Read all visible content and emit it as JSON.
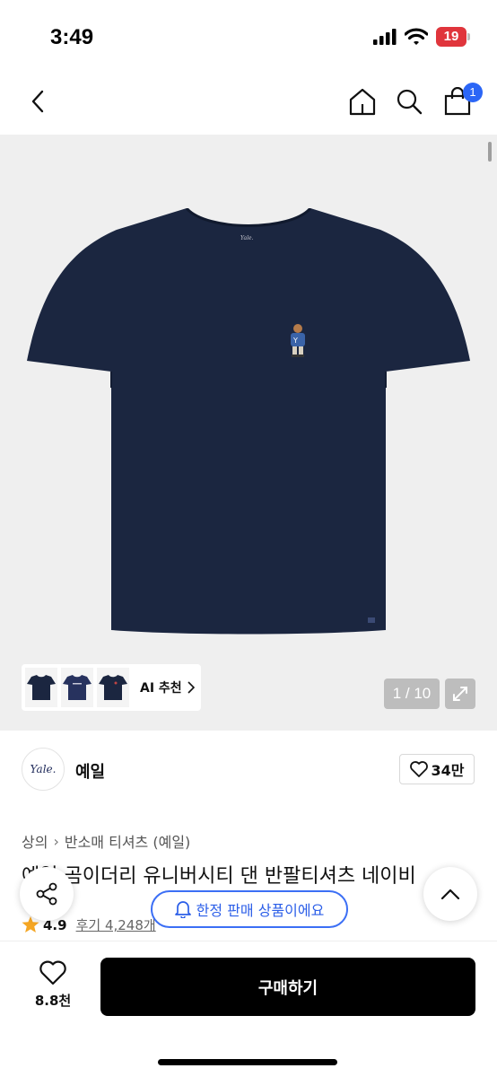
{
  "status_bar": {
    "time": "3:49",
    "battery_level": "19",
    "battery_color": "#e0353c"
  },
  "header": {
    "back_icon": "chevron-left-icon",
    "home_icon": "home-icon",
    "search_icon": "search-icon",
    "cart_icon": "shopping-bag-icon",
    "cart_count": "1"
  },
  "gallery": {
    "page_counter": "1 / 10",
    "expand_icon": "expand-icon",
    "ai_recommend_label": "AI 추천",
    "thumbnails": [
      "tshirt-thumbnail-1",
      "tshirt-thumbnail-2",
      "tshirt-thumbnail-3"
    ],
    "shirt_color": "#1b2640"
  },
  "brand": {
    "logo_text": "Yale.",
    "name": "예일",
    "like_count": "34만"
  },
  "product": {
    "breadcrumb": [
      "상의",
      "반소매 티셔츠 (예일)"
    ],
    "title": "예일 곰이더리 유니버시티 댄 반팔티셔츠 네이비",
    "rating": "4.9",
    "review_text": "후기 4,248개"
  },
  "floating": {
    "limited_label": "한정 판매 상품이에요",
    "share_icon": "share-icon",
    "top_icon": "chevron-up-icon"
  },
  "bottom_bar": {
    "wish_count": "8.8천",
    "buy_label": "구매하기"
  },
  "accent_colors": {
    "brand_blue": "#2b66f6",
    "star": "#f5a623",
    "buy_button": "#000000"
  }
}
